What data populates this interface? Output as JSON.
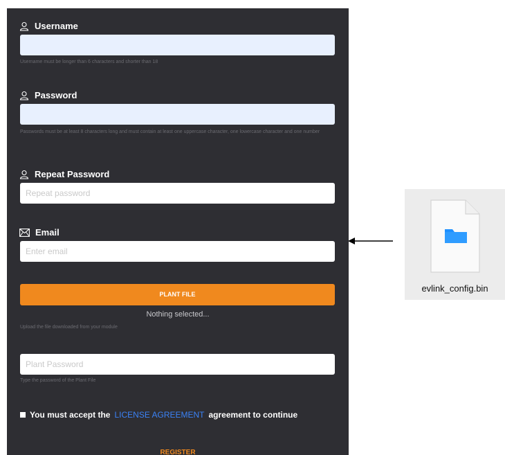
{
  "form": {
    "username": {
      "label": "Username",
      "value": "",
      "help": "Username must be longer than 6 characters and shorter than 18"
    },
    "password": {
      "label": "Password",
      "value": "",
      "help": "Passwords must be at least 8 characters long and must contain at least one uppercase character, one lowercase character and one number"
    },
    "repeat_password": {
      "label": "Repeat Password",
      "placeholder": "Repeat password"
    },
    "email": {
      "label": "Email",
      "placeholder": "Enter email"
    },
    "plant_file": {
      "button_label": "PLANT FILE",
      "status": "Nothing selected...",
      "help": "Upload the file downloaded from your module"
    },
    "plant_password": {
      "placeholder": "Plant Password",
      "help": "Type the password of the Plant File"
    },
    "license": {
      "prefix": "You must accept the",
      "link": "LICENSE AGREEMENT",
      "suffix": "agreement to continue"
    },
    "register_label": "REGISTER"
  },
  "file": {
    "name": "evlink_config.bin",
    "icon": "folder-icon"
  },
  "colors": {
    "panel_bg": "#2e2e33",
    "accent_orange": "#f0891e",
    "autofill_blue": "#e8f0fe",
    "link_blue": "#3b82f6",
    "folder_blue": "#1e90ff"
  }
}
